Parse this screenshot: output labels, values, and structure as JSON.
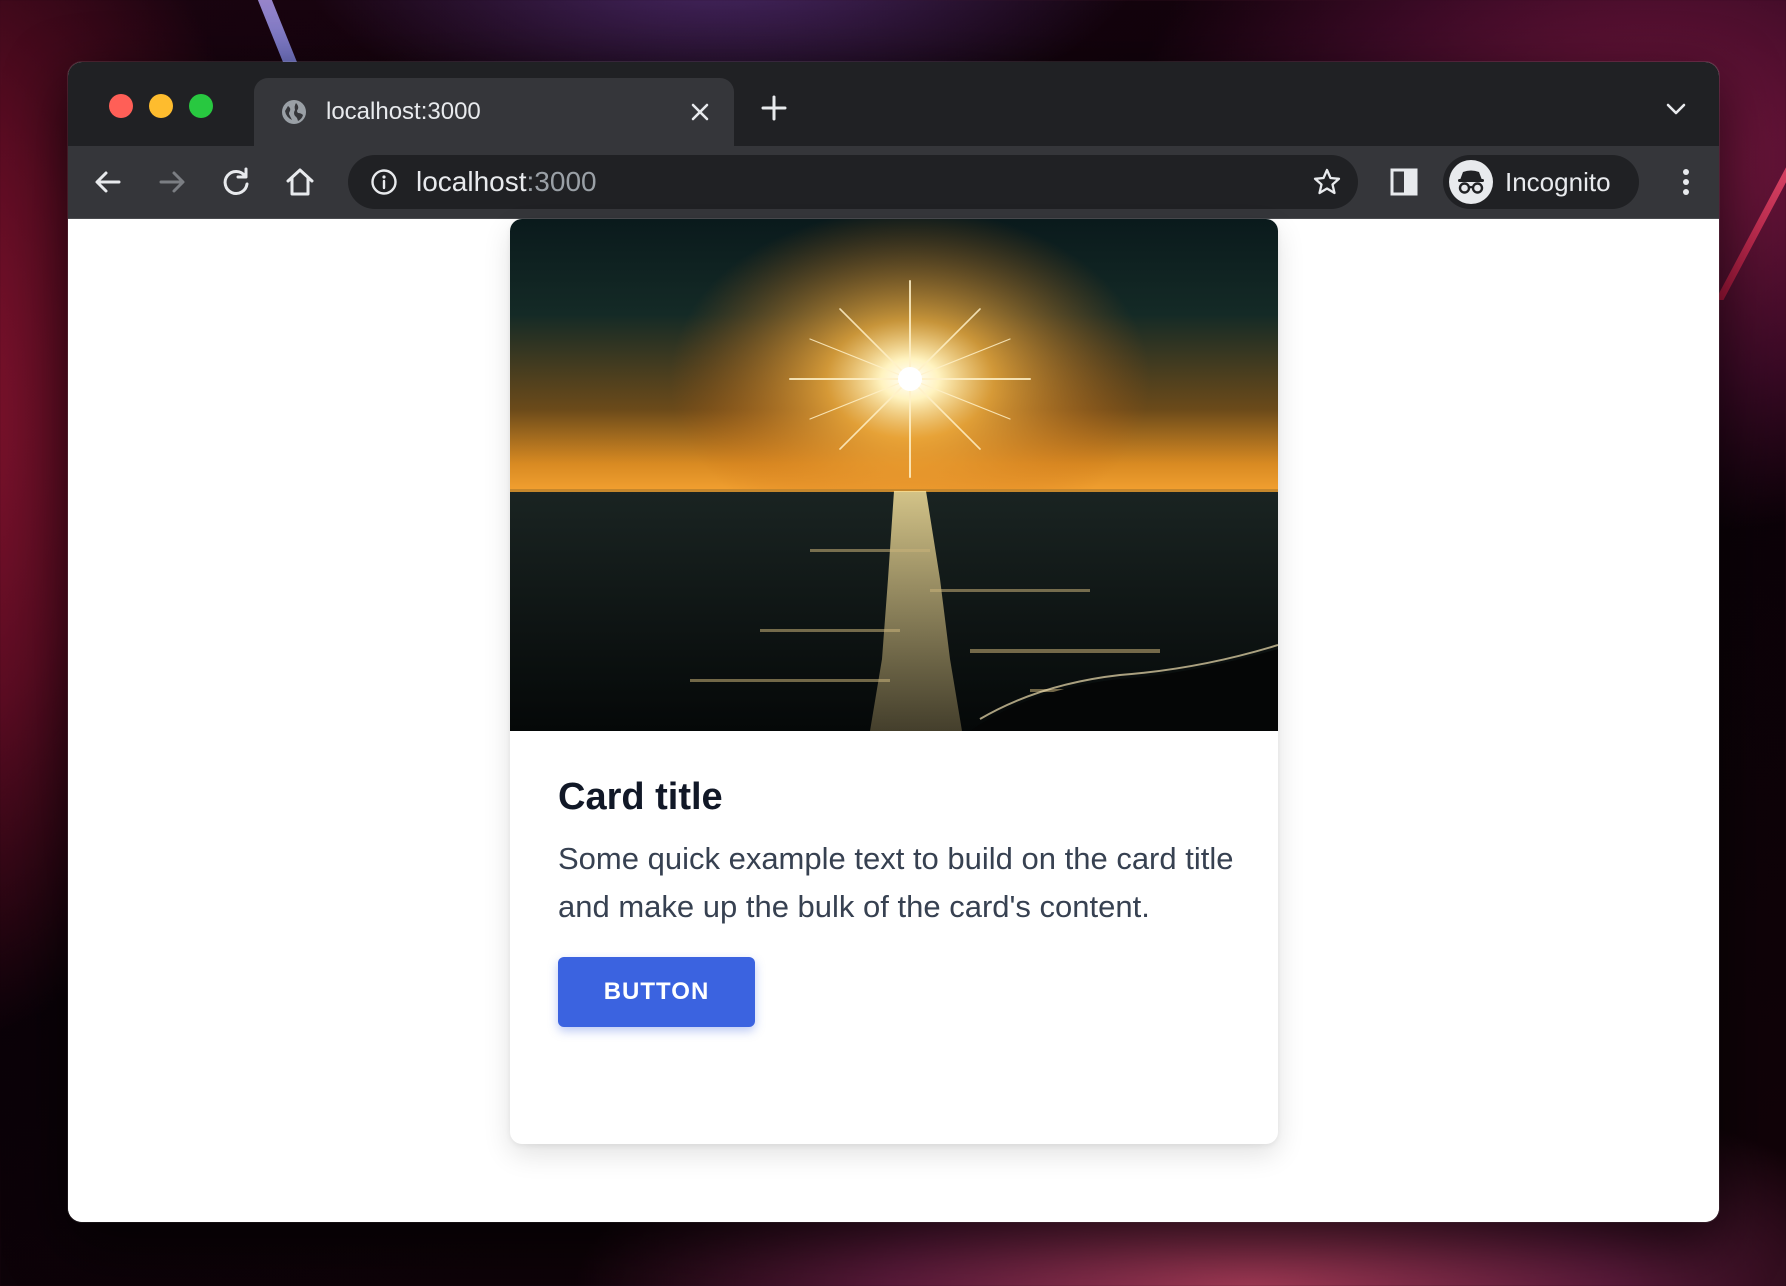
{
  "browser": {
    "tab": {
      "title": "localhost:3000"
    },
    "address_bar": {
      "host": "localhost",
      "port": ":3000"
    },
    "profile": {
      "label": "Incognito"
    }
  },
  "card": {
    "title": "Card title",
    "text": "Some quick example text to build on the card title and make up the bulk of the card's content.",
    "button_label": "BUTTON"
  },
  "colors": {
    "button": "#3b63e0",
    "tabstrip": "#202124",
    "toolbar": "#35363a"
  },
  "icons": [
    "globe-icon",
    "close-icon",
    "plus-icon",
    "chevron-down-icon",
    "back-arrow-icon",
    "forward-arrow-icon",
    "reload-icon",
    "home-icon",
    "info-icon",
    "star-icon",
    "side-panel-icon",
    "incognito-icon",
    "more-vert-icon"
  ]
}
